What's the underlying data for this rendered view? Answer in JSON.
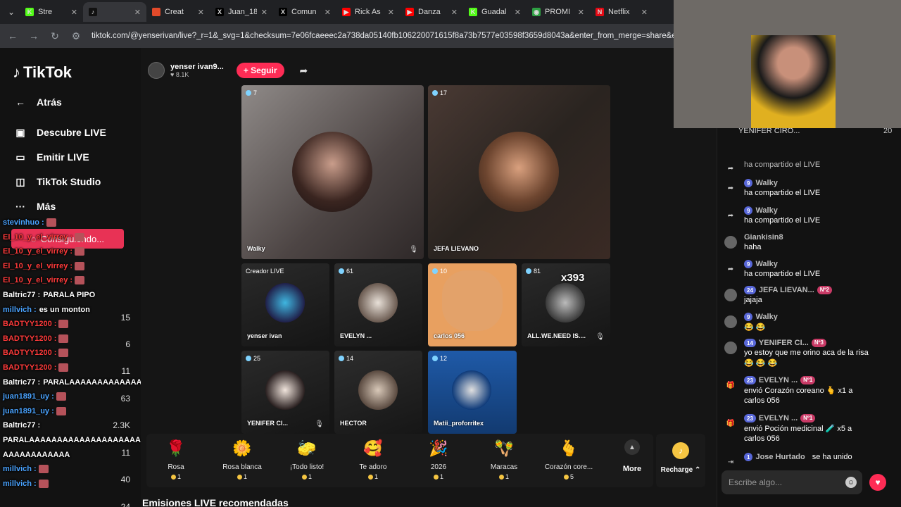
{
  "browser": {
    "tabs": [
      {
        "label": "Stre",
        "fav_color": "#53fc18",
        "fav_text": "K"
      },
      {
        "label": "",
        "fav_color": "#111",
        "fav_text": "♪",
        "active": true
      },
      {
        "label": "Creat",
        "fav_color": "#e24a2a",
        "fav_text": ""
      },
      {
        "label": "Juan_18",
        "fav_color": "#000",
        "fav_text": "X"
      },
      {
        "label": "Comun",
        "fav_color": "#000",
        "fav_text": "X"
      },
      {
        "label": "Rick As",
        "fav_color": "#ff0000",
        "fav_text": "▶"
      },
      {
        "label": "Danza",
        "fav_color": "#ff0000",
        "fav_text": "▶"
      },
      {
        "label": "Guadal",
        "fav_color": "#53fc18",
        "fav_text": "K"
      },
      {
        "label": "PROMI",
        "fav_color": "#2ea043",
        "fav_text": "◉"
      },
      {
        "label": "Netflix",
        "fav_color": "#e50914",
        "fav_text": "N"
      }
    ],
    "url": "tiktok.com/@yenserivan/live?_r=1&_svg=1&checksum=7e06fcaeeec2a738da05140fb106220071615f8a73b7577e03598f3659d8043a&enter_from_merge=share&enter_m"
  },
  "sidebar": {
    "logo": "TikTok",
    "back": "Atrás",
    "items": [
      {
        "label": "Descubre LIVE",
        "icon": "live-icon"
      },
      {
        "label": "Emitir LIVE",
        "icon": "camera-icon"
      },
      {
        "label": "TikTok Studio",
        "icon": "studio-icon"
      },
      {
        "label": "Más",
        "icon": "more-icon"
      }
    ],
    "loading": "Consiguiendo..."
  },
  "overlay_chat": [
    {
      "user": "stevinhuo :",
      "text": "",
      "cls": "u1"
    },
    {
      "user": "El_10_y_el_virrey :",
      "text": "",
      "cls": "u2"
    },
    {
      "user": "El_10_y_el_virrey :",
      "text": "",
      "cls": "u2"
    },
    {
      "user": "El_10_y_el_virrey :",
      "text": "",
      "cls": "u2"
    },
    {
      "user": "El_10_y_el_virrey :",
      "text": "",
      "cls": "u2"
    },
    {
      "user": "Baltric77 :",
      "text": "PARALA PIPO",
      "cls": "u3"
    },
    {
      "user": "millvich :",
      "text": "es un monton",
      "cls": "u1"
    },
    {
      "user": "BADTYY1200 :",
      "text": "",
      "cls": "u2"
    },
    {
      "user": "BADTYY1200 :",
      "text": "",
      "cls": "u2"
    },
    {
      "user": "BADTYY1200 :",
      "text": "",
      "cls": "u2"
    },
    {
      "user": "BADTYY1200 :",
      "text": "",
      "cls": "u2"
    },
    {
      "user": "Baltric77 :",
      "text": "PARALAAAAAAAAAAAAAA",
      "cls": "u3"
    },
    {
      "user": "juan1891_uy :",
      "text": "",
      "cls": "u1"
    },
    {
      "user": "juan1891_uy :",
      "text": "",
      "cls": "u1"
    },
    {
      "user": "Baltric77 :",
      "text": "",
      "cls": "u3"
    },
    {
      "user": "PARALAAAAAAAAAAAAAAAAAAAAAAAAAA",
      "text": "",
      "cls": "u3"
    },
    {
      "user": "AAAAAAAAAAAA",
      "text": "",
      "cls": "u3"
    },
    {
      "user": "millvich :",
      "text": "",
      "cls": "u1"
    },
    {
      "user": "millvich :",
      "text": "",
      "cls": "u1"
    }
  ],
  "overlay_numbers": [
    "15",
    "6",
    "11",
    "63",
    "2.3K",
    "11",
    "40",
    "24"
  ],
  "stream": {
    "host_name": "yenser ivan9...",
    "host_likes": "8.1K",
    "follow": "+ Seguir",
    "cells": [
      {
        "count": "7",
        "name": "Walky"
      },
      {
        "count": "17",
        "name": "JEFA LIEVANO"
      },
      {
        "count": "",
        "name": "yenser ivan",
        "label": "Creador LIVE"
      },
      {
        "count": "61",
        "name": "EVELYN ..."
      },
      {
        "count": "10",
        "name": "carlos 056"
      },
      {
        "count": "81",
        "name": "ALL.WE.NEED IS....",
        "extra": "x393"
      },
      {
        "count": "25",
        "name": "YENIFER CI..."
      },
      {
        "count": "14",
        "name": "HECTOR"
      },
      {
        "count": "12",
        "name": "Matii_proforritex"
      }
    ]
  },
  "gifts": [
    {
      "name": "Rosa",
      "price": "1",
      "icon": "🌹"
    },
    {
      "name": "Rosa blanca",
      "price": "1",
      "icon": "🌼"
    },
    {
      "name": "¡Todo listo!",
      "price": "1",
      "icon": "🧽"
    },
    {
      "name": "Te adoro",
      "price": "1",
      "icon": "🥰"
    },
    {
      "name": "2026",
      "price": "1",
      "icon": "🎉"
    },
    {
      "name": "Maracas",
      "price": "1",
      "icon": "🪇"
    },
    {
      "name": "Corazón core...",
      "price": "5",
      "icon": "🫰"
    }
  ],
  "more_label": "More",
  "recharge_label": "Recharge",
  "recs_title": "Emisiones LIVE recomendadas",
  "chat": {
    "top_user": "YENIFER CIRO...",
    "top_count": "20",
    "messages": [
      {
        "type": "share",
        "name": "",
        "level": "",
        "text": "ha compartido el LIVE"
      },
      {
        "type": "share",
        "name": "Walky",
        "level": "9",
        "text": "ha compartido el LIVE"
      },
      {
        "type": "share",
        "name": "Walky",
        "level": "9",
        "text": "ha compartido el LIVE"
      },
      {
        "type": "avatar",
        "name": "Giankisin8",
        "level": "",
        "text": "haha"
      },
      {
        "type": "share",
        "name": "Walky",
        "level": "9",
        "text": "ha compartido el LIVE"
      },
      {
        "type": "avatar",
        "name": "JEFA LIEVAN...",
        "level": "24",
        "fan": "Nº2",
        "text": "jajaja"
      },
      {
        "type": "avatar",
        "name": "Walky",
        "level": "9",
        "text": "😂 😂"
      },
      {
        "type": "avatar",
        "name": "YENIFER CI...",
        "level": "14",
        "fan": "Nº3",
        "text": "yo estoy que me orino aca de la risa",
        "text2": "😂 😂 😂"
      },
      {
        "type": "gift",
        "name": "EVELYN ...",
        "level": "23",
        "fan": "Nº1",
        "text": "envió Corazón coreano 🫰 x1 a",
        "text2": "carlos 056"
      },
      {
        "type": "gift",
        "name": "EVELYN ...",
        "level": "23",
        "fan": "Nº1",
        "text": "envió Poción medicinal 🧪 x5 a",
        "text2": "carlos 056"
      },
      {
        "type": "join",
        "name": "Jose Hurtado",
        "level": "1",
        "text": "se ha unido"
      }
    ],
    "input_placeholder": "Escribe algo..."
  }
}
